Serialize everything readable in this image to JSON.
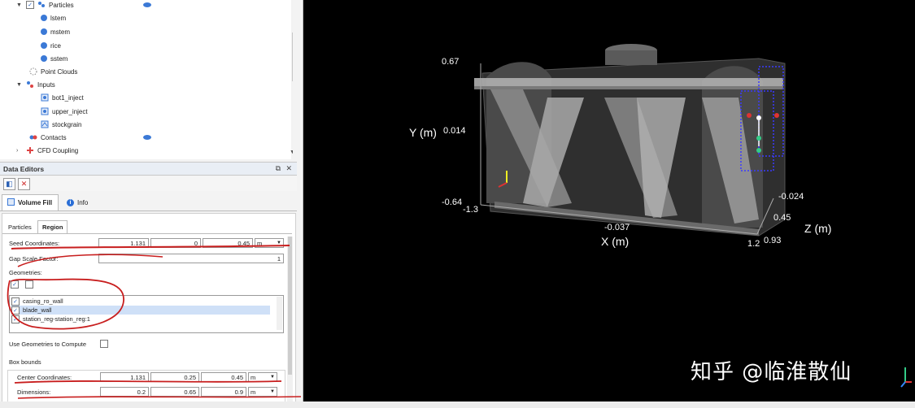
{
  "tree": {
    "items": [
      {
        "label": "Particles",
        "level": 1
      },
      {
        "label": "lstem",
        "level": 2
      },
      {
        "label": "mstem",
        "level": 2
      },
      {
        "label": "rice",
        "level": 2
      },
      {
        "label": "sstem",
        "level": 2
      },
      {
        "label": "Point Clouds",
        "level": 1
      },
      {
        "label": "Inputs",
        "level": 1
      },
      {
        "label": "bot1_inject",
        "level": 2
      },
      {
        "label": "upper_inject",
        "level": 2
      },
      {
        "label": "stockgrain",
        "level": 2
      },
      {
        "label": "Contacts",
        "level": 1
      },
      {
        "label": "CFD Coupling",
        "level": 1
      }
    ]
  },
  "data_editors": {
    "title": "Data Editors",
    "tabs": [
      "Volume Fill",
      "Info"
    ],
    "subtabs": [
      "Particles",
      "Region"
    ]
  },
  "form": {
    "seed_label": "Seed Coordinates:",
    "seed_values": [
      "1.131",
      "0",
      "0.45"
    ],
    "seed_unit": "m",
    "gap_label": "Gap Scale Factor:",
    "gap_value": "1",
    "geometries_label": "Geometries:",
    "geometries": [
      "casing_ro_wall",
      "blade_wall",
      "station_reg-station_reg:1"
    ],
    "use_geom_label": "Use Geometries to Compute",
    "box_label": "Box bounds",
    "center_label": "Center Coordinates:",
    "center_values": [
      "1.131",
      "0.25",
      "0.45"
    ],
    "center_unit": "m",
    "dims_label": "Dimensions:",
    "dims_values": [
      "0.2",
      "0.65",
      "0.9"
    ],
    "dims_unit": "m"
  },
  "viewport": {
    "y_label": "Y (m)",
    "x_label": "X (m)",
    "z_label": "Z (m)",
    "y_ticks": [
      "0.67",
      "0.014",
      "-0.64"
    ],
    "x_ticks": [
      "-1.3",
      "-0.037",
      "1.2"
    ],
    "z_ticks": [
      "-0.024",
      "0.45",
      "0.93"
    ],
    "watermark": "知乎 @临淮散仙"
  }
}
